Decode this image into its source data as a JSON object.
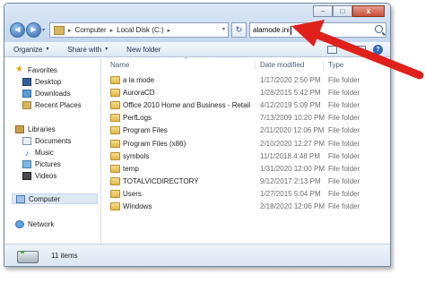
{
  "window": {
    "caption_buttons": {
      "minimize": "–",
      "maximize": "□",
      "close": "x"
    }
  },
  "navigation": {
    "back_glyph": "◄",
    "forward_glyph": "►",
    "history_glyph": "▾"
  },
  "address": {
    "icon": "folder-icon",
    "separator": "▸",
    "crumbs": [
      "Computer",
      "Local Disk (C:)"
    ],
    "dropdown_glyph": "▾",
    "refresh_glyph": "↻"
  },
  "search": {
    "value": "alamode.ini",
    "icon": "search-icon"
  },
  "toolbar": {
    "organize": "Organize",
    "share_with": "Share with",
    "new_folder": "New folder",
    "dropdown_glyph": "▼",
    "help_glyph": "?"
  },
  "sidebar": {
    "favorites": {
      "title": "Favorites",
      "items": [
        "Desktop",
        "Downloads",
        "Recent Places"
      ]
    },
    "libraries": {
      "title": "Libraries",
      "items": [
        "Documents",
        "Music",
        "Pictures",
        "Videos"
      ]
    },
    "computer": "Computer",
    "network": "Network"
  },
  "columns": {
    "name": "Name",
    "date_modified": "Date modified",
    "type": "Type",
    "sort_glyph": "^"
  },
  "files": [
    {
      "name": "a la mode",
      "date": "1/17/2020 2:50 PM",
      "type": "File folder"
    },
    {
      "name": "AuroraCD",
      "date": "1/28/2015 5:42 PM",
      "type": "File folder"
    },
    {
      "name": "Office 2010 Home and Business - Retail",
      "date": "4/12/2019 5:09 PM",
      "type": "File folder"
    },
    {
      "name": "PerfLogs",
      "date": "7/13/2009 10:20 PM",
      "type": "File folder"
    },
    {
      "name": "Program Files",
      "date": "2/11/2020 12:06 PM",
      "type": "File folder"
    },
    {
      "name": "Program Files (x86)",
      "date": "2/10/2020 12:27 PM",
      "type": "File folder"
    },
    {
      "name": "symbols",
      "date": "11/1/2018 4:48 PM",
      "type": "File folder"
    },
    {
      "name": "temp",
      "date": "1/31/2020 12:00 PM",
      "type": "File folder"
    },
    {
      "name": "TOTALVICDIRECTORY",
      "date": "9/12/2017 2:13 PM",
      "type": "File folder"
    },
    {
      "name": "Users",
      "date": "1/27/2015 5:04 PM",
      "type": "File folder"
    },
    {
      "name": "Windows",
      "date": "2/18/2020 12:06 PM",
      "type": "File folder"
    }
  ],
  "status": {
    "item_count": "11 items"
  },
  "colors": {
    "annotation_arrow": "#e0201b",
    "folder": "#e2b84a",
    "chrome": "#c4d7ee"
  }
}
